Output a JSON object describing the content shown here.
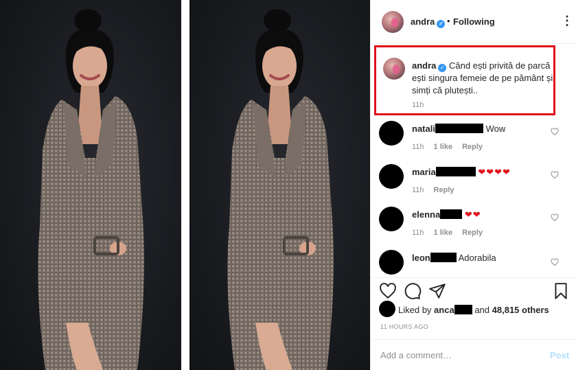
{
  "post": {
    "username": "andra",
    "follow_status": "Following",
    "separator": "•"
  },
  "caption": {
    "username": "andra",
    "text": "Când ești privită de parcă ești singura femeie de pe pământ și simți că plutești..",
    "time": "11h"
  },
  "comments": [
    {
      "username": "natali",
      "text": "Wow",
      "time": "11h",
      "likes": "1 like",
      "reply": "Reply"
    },
    {
      "username": "maria",
      "text": "",
      "hearts": "❤❤❤❤",
      "time": "11h",
      "reply": "Reply"
    },
    {
      "username": "elenna",
      "text": "",
      "hearts": "❤❤",
      "time": "11h",
      "likes": "1 like",
      "reply": "Reply"
    },
    {
      "username": "leon",
      "text": "Adorabila"
    }
  ],
  "likes": {
    "prefix": "Liked by",
    "user": "anca",
    "middle": "and",
    "count": "48,815 others"
  },
  "time_ago": "11 HOURS AGO",
  "add_comment": {
    "placeholder": "Add a comment…",
    "post_label": "Post"
  },
  "colors": {
    "highlight_border": "#e0101c",
    "verified": "#3897f0",
    "muted_text": "#8e8e8e",
    "post_disabled": "#b2dffc"
  },
  "icons": [
    "more-options-icon",
    "verified-badge-icon",
    "heart-icon",
    "comment-icon",
    "share-icon",
    "bookmark-icon"
  ]
}
